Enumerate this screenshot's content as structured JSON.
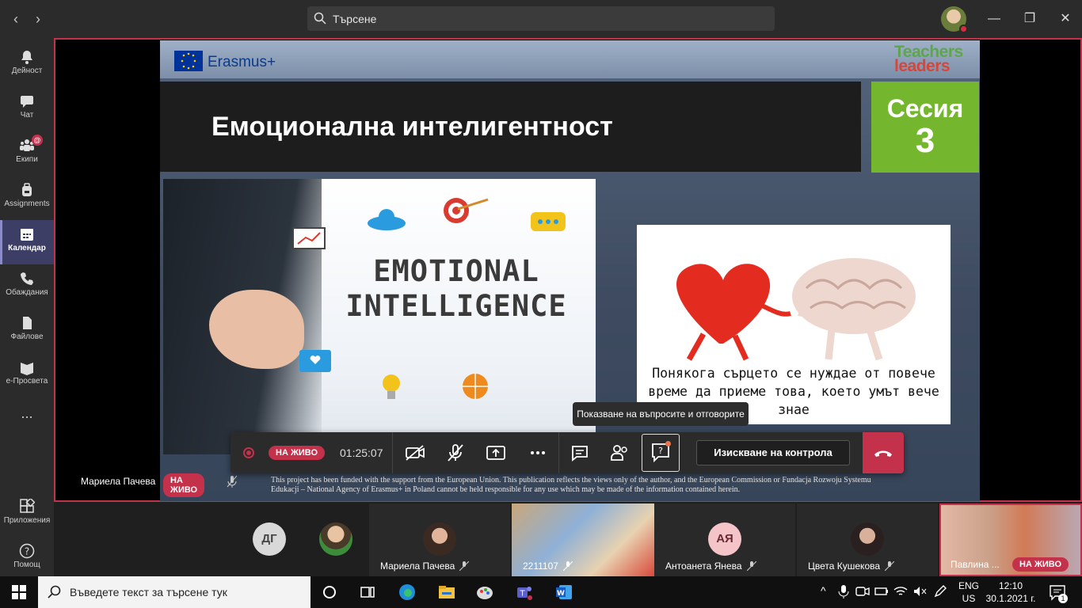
{
  "search": {
    "placeholder": "Търсене"
  },
  "rail": {
    "items": [
      {
        "label": "Дейност"
      },
      {
        "label": "Чат"
      },
      {
        "label": "Екипи",
        "badge": "@"
      },
      {
        "label": "Assignments"
      },
      {
        "label": "Календар"
      },
      {
        "label": "Обаждания"
      },
      {
        "label": "Файлове"
      },
      {
        "label": "е-Просвета"
      },
      {
        "label": "..."
      },
      {
        "label": "Приложения"
      },
      {
        "label": "Помощ"
      }
    ]
  },
  "slide": {
    "erasmus": "Erasmus+",
    "logo_top": "Teachers",
    "logo_bottom": "leaders",
    "title": "Емоционална интелигентност",
    "session_label": "Сесия",
    "session_number": "3",
    "image_text_1": "EMOTIONAL",
    "image_text_2": "INTELLIGENCE",
    "caption": "Понякога сърцето се нуждае от повече време да приеме това, което умът вече знае",
    "disclaimer": "This project has been funded with the support from the European Union. This publication reflects the views only of the author, and the European Commission or Fundacja Rozwoju Systemu Edukacji – National Agency of Erasmus+ in Poland cannot be held responsible for any use which may be made of the information contained herein."
  },
  "presenter": {
    "name": "Мариела Пачева",
    "live": "НА ЖИВО"
  },
  "callbar": {
    "live": "НА ЖИВО",
    "timer": "01:25:07",
    "tooltip": "Показване на въпросите и отговорите",
    "request_control": "Изискване на контрола"
  },
  "gallery": {
    "tiles": [
      {
        "initials": "ДГ",
        "name": ""
      },
      {
        "initials": "",
        "name": ""
      },
      {
        "initials": "",
        "name": "Мариела Пачева"
      },
      {
        "initials": "",
        "name": "2211107"
      },
      {
        "initials": "АЯ",
        "name": "Антоанета Янева"
      },
      {
        "initials": "",
        "name": "Цвета Кушекова"
      },
      {
        "initials": "",
        "name": "Павлина ...",
        "live": "НА ЖИВО"
      }
    ]
  },
  "taskbar": {
    "search_placeholder": "Въведете текст за търсене тук",
    "lang_1": "ENG",
    "lang_2": "US",
    "time": "12:10",
    "date": "30.1.2021 г.",
    "notifications": "1"
  },
  "colors": {
    "accent": "#c4314b",
    "rail_active": "#3d3e66",
    "session_green": "#74b72e"
  }
}
